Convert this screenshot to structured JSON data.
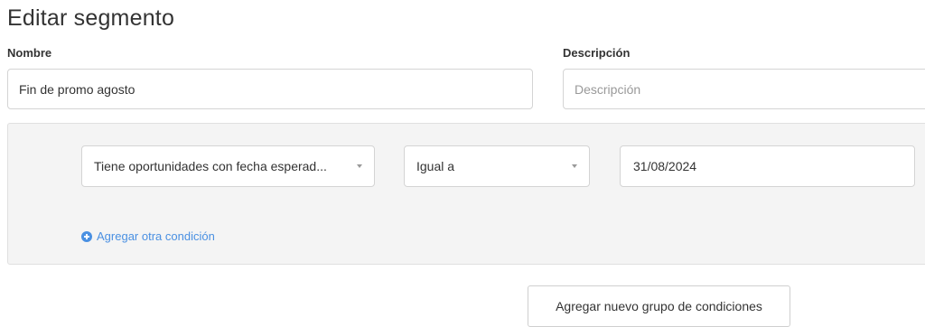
{
  "page": {
    "title": "Editar segmento"
  },
  "form": {
    "name_label": "Nombre",
    "name_value": "Fin de promo agosto",
    "description_label": "Descripción",
    "description_placeholder": "Descripción"
  },
  "condition_group": {
    "conditions": [
      {
        "field": "Tiene oportunidades con fecha esperad...",
        "operator": "Igual a",
        "value": "31/08/2024"
      }
    ],
    "add_condition_label": "Agregar otra condición"
  },
  "actions": {
    "add_group_label": "Agregar nuevo grupo de condiciones"
  },
  "icons": {
    "add_condition": "plus-circle-icon",
    "dropdown": "chevron-down-icon"
  },
  "colors": {
    "link": "#4a90e2",
    "group_bg": "#f4f4f4"
  }
}
